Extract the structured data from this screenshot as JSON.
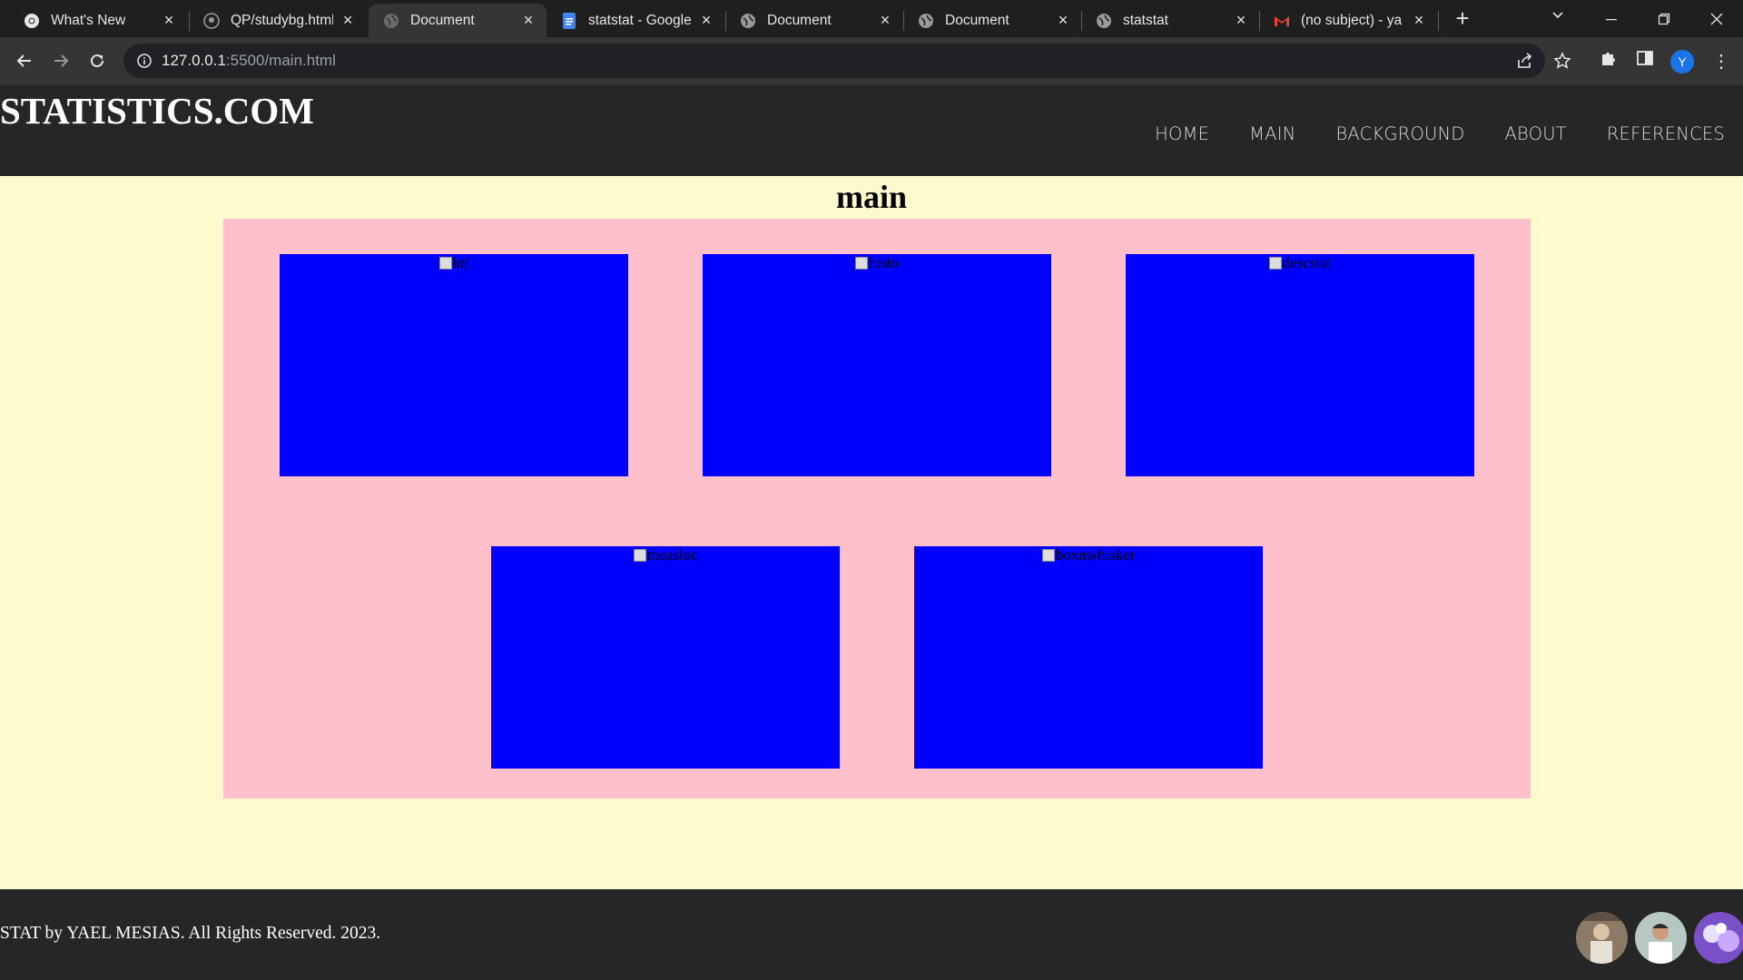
{
  "browser": {
    "tabs": [
      {
        "title": "What's New",
        "icon": "chrome-icon",
        "active": false
      },
      {
        "title": "QP/studybg.html",
        "icon": "github-icon",
        "active": false
      },
      {
        "title": "Document",
        "icon": "globe-icon",
        "active": true
      },
      {
        "title": "statstat - Google",
        "icon": "docs-icon",
        "active": false
      },
      {
        "title": "Document",
        "icon": "globe-icon",
        "active": false
      },
      {
        "title": "Document",
        "icon": "globe-icon",
        "active": false
      },
      {
        "title": "statstat",
        "icon": "globe-icon",
        "active": false
      },
      {
        "title": "(no subject) - ya",
        "icon": "gmail-icon",
        "active": false
      }
    ],
    "url_host": "127.0.0.1",
    "url_rest": ":5500/main.html",
    "profile_initial": "Y",
    "profile_color": "#1a73e8"
  },
  "site": {
    "logo": "STATISTICS.COM",
    "nav": [
      "HOME",
      "MAIN",
      "BACKGROUND",
      "ABOUT",
      "REFERENCES"
    ],
    "page_title": "main",
    "images": [
      {
        "alt": "ktt"
      },
      {
        "alt": "histo"
      },
      {
        "alt": "descstat"
      },
      {
        "alt": "measloc"
      },
      {
        "alt": "boxnwhisker"
      }
    ],
    "footer_text": "STAT by YAEL MESIAS. All Rights Reserved. 2023.",
    "colors": {
      "header_bg": "#262626",
      "page_bg": "#fffacd",
      "gallery_bg": "#ffc0cb",
      "image_bg": "#0000ff"
    }
  }
}
